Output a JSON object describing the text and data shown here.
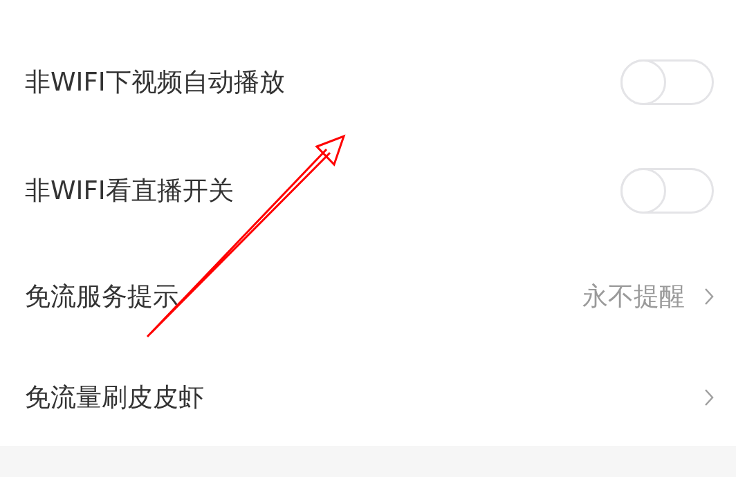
{
  "settings": [
    {
      "kind": "toggle",
      "label": "非WIFI下视频自动播放",
      "on": false
    },
    {
      "kind": "toggle",
      "label": "非WIFI看直播开关",
      "on": false
    },
    {
      "kind": "link",
      "label": "免流服务提示",
      "value": "永不提醒"
    },
    {
      "kind": "link",
      "label": "免流量刷皮皮虾"
    }
  ]
}
